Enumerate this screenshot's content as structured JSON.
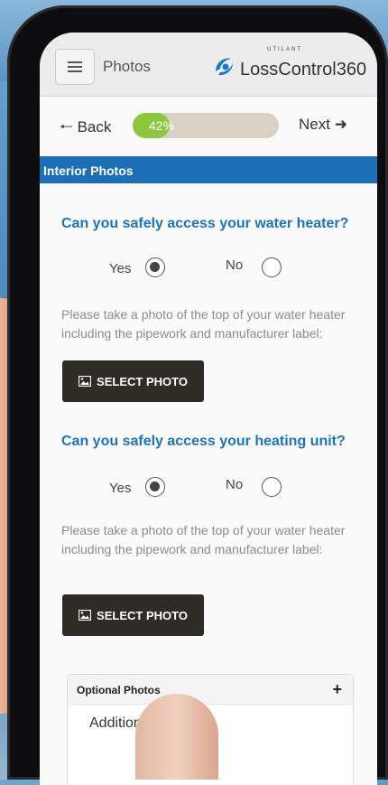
{
  "header": {
    "title": "Photos",
    "brand_small": "UTILANT",
    "brand_name": "LossControl360"
  },
  "nav": {
    "back_label": "Back",
    "next_label": "Next",
    "progress_value": 42,
    "progress_text": "42%"
  },
  "section": {
    "title": "Interior Photos"
  },
  "questions": [
    {
      "text": "Can you safely access your water heater?",
      "yes_label": "Yes",
      "no_label": "No",
      "selected": "yes",
      "hint": "Please take a photo of the top of your water heater including the pipework and manufacturer label:",
      "button_label": "SELECT PHOTO"
    },
    {
      "text": "Can you safely access your heating unit?",
      "yes_label": "Yes",
      "no_label": "No",
      "selected": "yes",
      "hint": "Please take a photo of the top of your water heater including the pipework and manufacturer label:",
      "button_label": "SELECT PHOTO"
    }
  ],
  "optional": {
    "title": "Optional Photos",
    "plus": "+",
    "item": "Additiona"
  },
  "colors": {
    "accent": "#1e74bb",
    "section_bar": "#1c6eb5",
    "progress": "#8dc63f",
    "button": "#2f2c25"
  }
}
